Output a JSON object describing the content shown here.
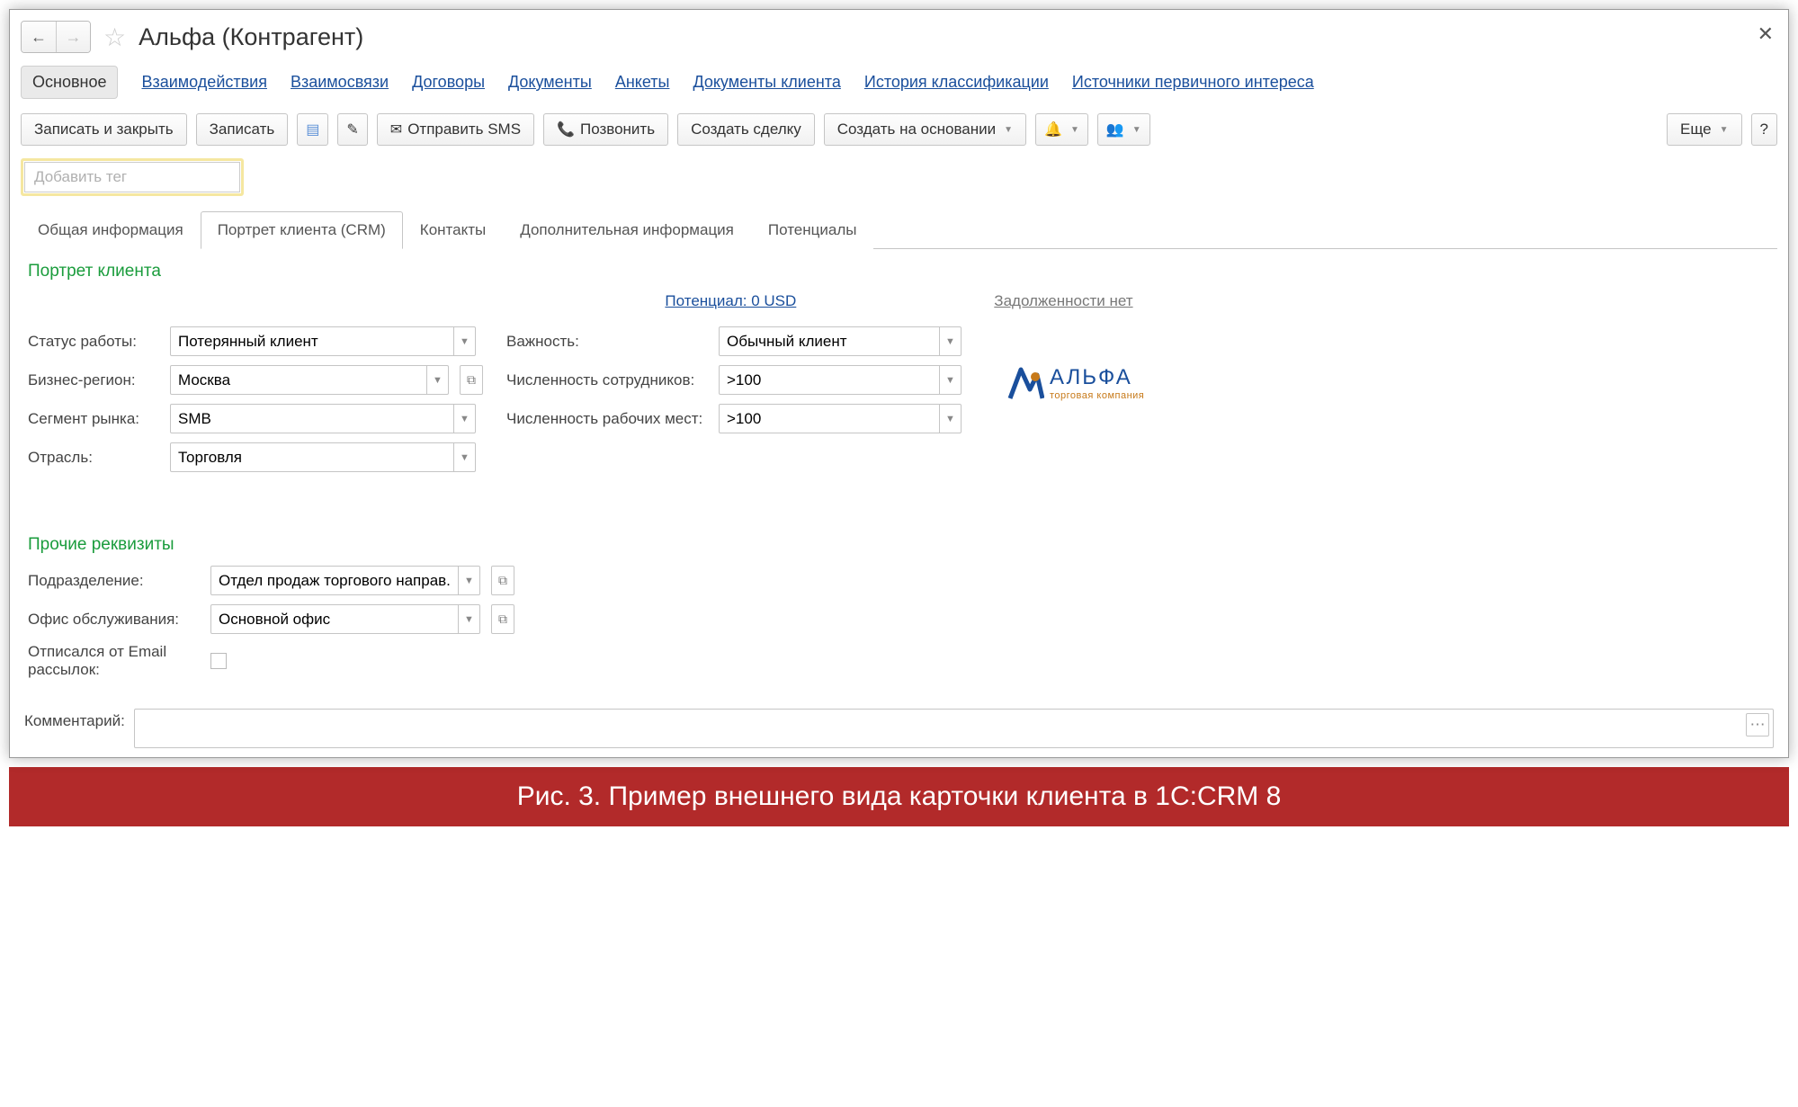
{
  "title": "Альфа (Контрагент)",
  "navLinks": [
    "Основное",
    "Взаимодействия",
    "Взаимосвязи",
    "Договоры",
    "Документы",
    "Анкеты",
    "Документы клиента",
    "История классификации",
    "Источники первичного интереса"
  ],
  "toolbar": {
    "saveClose": "Записать и закрыть",
    "save": "Записать",
    "sendSms": "Отправить SMS",
    "call": "Позвонить",
    "createDeal": "Создать сделку",
    "createBased": "Создать на основании",
    "more": "Еще",
    "help": "?"
  },
  "tagPlaceholder": "Добавить тег",
  "tabs": [
    "Общая информация",
    "Портрет клиента (CRM)",
    "Контакты",
    "Дополнительная информация",
    "Потенциалы"
  ],
  "portrait": {
    "heading": "Портрет клиента",
    "potential": "Потенциал: 0 USD",
    "noDebt": "Задолженности нет",
    "labels": {
      "status": "Статус работы:",
      "region": "Бизнес-регион:",
      "segment": "Сегмент рынка:",
      "branch": "Отрасль:",
      "importance": "Важность:",
      "employees": "Численность сотрудников:",
      "workplaces": "Численность рабочих мест:"
    },
    "values": {
      "status": "Потерянный клиент",
      "region": "Москва",
      "segment": "SMB",
      "branch": "Торговля",
      "importance": "Обычный клиент",
      "employees": ">100",
      "workplaces": ">100"
    }
  },
  "logo": {
    "name": "АЛЬФА",
    "sub": "торговая компания"
  },
  "other": {
    "heading": "Прочие реквизиты",
    "labels": {
      "dept": "Подразделение:",
      "office": "Офис обслуживания:",
      "unsub": "Отписался от Email рассылок:"
    },
    "values": {
      "dept": "Отдел продаж торгового направ.",
      "office": "Основной офис"
    }
  },
  "commentLabel": "Комментарий:",
  "caption": "Рис. 3. Пример внешнего вида карточки клиента в 1C:CRM 8"
}
